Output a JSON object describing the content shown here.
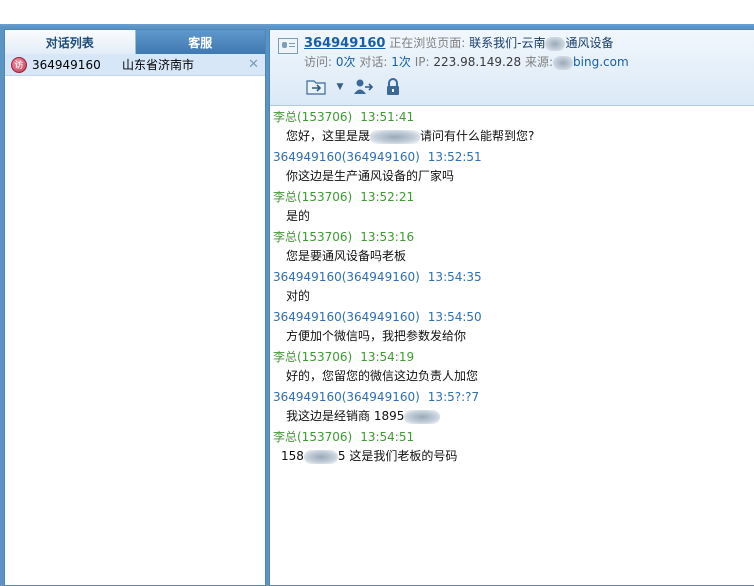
{
  "left_panel": {
    "tabs": [
      "对话列表",
      "客服"
    ],
    "conversations": [
      {
        "id": "364949160",
        "location": "山东省济南市"
      }
    ]
  },
  "header": {
    "visitor_id": "364949160",
    "browsing_label": "正在浏览页面:",
    "page_title_start": "联系我们-云南",
    "page_title_end": "通风设备",
    "visits_label": "访问:",
    "visits_value": "0次",
    "chats_label": "对话:",
    "chats_value": "1次",
    "ip_label": "IP:",
    "ip_value": "223.98.149.28",
    "source_label": "来源:",
    "source_value": "bing.com"
  },
  "messages": [
    {
      "sender": "李总(153706)",
      "time": "13:51:41",
      "role": "agent",
      "text": "您好，这里是晟",
      "text_after": "请问有什么能帮到您?"
    },
    {
      "sender": "364949160(364949160)",
      "time": "13:52:51",
      "role": "visitor",
      "text": "你这边是生产通风设备的厂家吗",
      "text_after": ""
    },
    {
      "sender": "李总(153706)",
      "time": "13:52:21",
      "role": "agent",
      "text": "是的",
      "text_after": ""
    },
    {
      "sender": "李总(153706)",
      "time": "13:53:16",
      "role": "agent",
      "text": "您是要通风设备吗老板",
      "text_after": ""
    },
    {
      "sender": "364949160(364949160)",
      "time": "13:54:35",
      "role": "visitor",
      "text": "对的",
      "text_after": ""
    },
    {
      "sender": "364949160(364949160)",
      "time": "13:54:50",
      "role": "visitor",
      "text": "方便加个微信吗，我把参数发给你",
      "text_after": ""
    },
    {
      "sender": "李总(153706)",
      "time": "13:54:19",
      "role": "agent",
      "text": "好的，您留您的微信这边负责人加您",
      "text_after": ""
    },
    {
      "sender": "364949160(364949160)",
      "time": "13:5?:?7",
      "role": "visitor",
      "text": "我这边是经销商  1895",
      "text_after": ""
    },
    {
      "sender": "李总(153706)",
      "time": "13:54:51",
      "role": "agent",
      "text": "158",
      "text_after": "5 这是我们老板的号码"
    }
  ],
  "colors": {
    "frame": "#5b93c4",
    "agent_name": "#3f9a32",
    "visitor_name": "#2f6fb1",
    "selected_row": "#d7e7f7"
  },
  "icons": [
    "vcard-icon",
    "folder-transfer-icon",
    "user-transfer-icon",
    "lock-icon",
    "close-icon",
    "visitor-status-icon"
  ]
}
